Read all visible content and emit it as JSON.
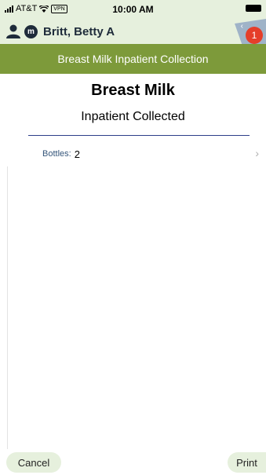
{
  "status_bar": {
    "carrier": "AT&T",
    "vpn": "VPN",
    "time": "10:00 AM"
  },
  "patient": {
    "avatar_letter": "m",
    "name": "Britt, Betty A"
  },
  "notifications": {
    "count": "1"
  },
  "header": {
    "title": "Breast Milk Inpatient Collection"
  },
  "form": {
    "title": "Breast Milk",
    "subtitle": "Inpatient Collected",
    "bottles_label": "Bottles:",
    "bottles_value": "2"
  },
  "buttons": {
    "cancel": "Cancel",
    "print": "Print"
  },
  "colors": {
    "header_green": "#7d9a3a",
    "top_tint": "#e6f0dd",
    "divider_blue": "#2d3e8a",
    "badge_red": "#e53e2a"
  }
}
